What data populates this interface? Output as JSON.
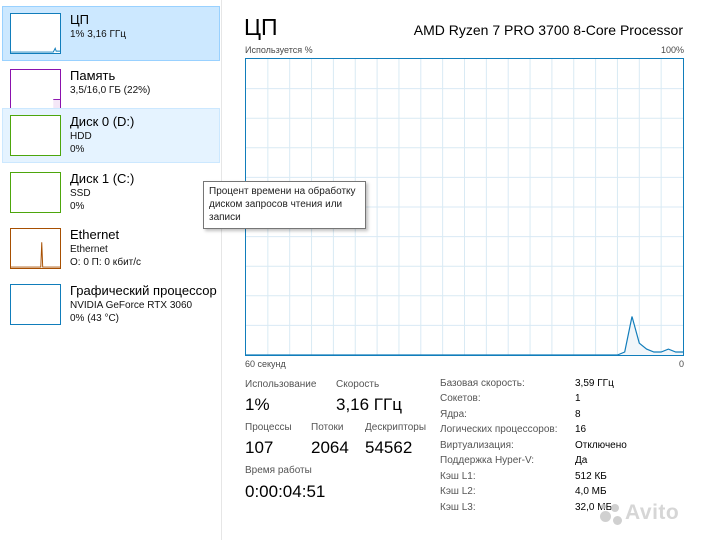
{
  "sidebar": {
    "items": [
      {
        "title": "ЦП",
        "sub1": "1% 3,16 ГГц",
        "sub2": "",
        "border": "#117dbb",
        "state": "selected"
      },
      {
        "title": "Память",
        "sub1": "3,5/16,0 ГБ (22%)",
        "sub2": "",
        "border": "#8b12ae",
        "state": ""
      },
      {
        "title": "Диск 0 (D:)",
        "sub1": "HDD",
        "sub2": "0%",
        "border": "#4da60c",
        "state": "hovered"
      },
      {
        "title": "Диск 1 (C:)",
        "sub1": "SSD",
        "sub2": "0%",
        "border": "#4da60c",
        "state": ""
      },
      {
        "title": "Ethernet",
        "sub1": "Ethernet",
        "sub2": "О: 0 П: 0 кбит/с",
        "border": "#a74f01",
        "state": ""
      },
      {
        "title": "Графический процессор",
        "sub1": "NVIDIA GeForce RTX 3060",
        "sub2": "0% (43 °C)",
        "border": "#117dbb",
        "state": ""
      }
    ]
  },
  "main": {
    "title": "ЦП",
    "cpu_name": "AMD Ryzen 7 PRO 3700 8-Core Processor",
    "axis": {
      "top_left": "Используется %",
      "top_right": "100%",
      "bottom_left": "60 секунд",
      "bottom_right": "0"
    }
  },
  "chart_data": {
    "type": "area",
    "ylabel": "Используется %",
    "ylim": [
      0,
      100
    ],
    "xlim": [
      60,
      0
    ],
    "x_unit": "секунд",
    "grid": true,
    "color": "#117dbb",
    "fill": "#f1f6fa",
    "x": [
      60,
      9,
      8,
      7,
      6,
      5,
      4,
      3,
      2,
      1,
      0
    ],
    "values": [
      0,
      0,
      1,
      13,
      4,
      2,
      1,
      1,
      2,
      1,
      1
    ]
  },
  "stats": {
    "usage_label": "Использование",
    "usage_value": "1%",
    "speed_label": "Скорость",
    "speed_value": "3,16 ГГц",
    "processes_label": "Процессы",
    "processes_value": "107",
    "threads_label": "Потоки",
    "threads_value": "2064",
    "handles_label": "Дескрипторы",
    "handles_value": "54562",
    "uptime_label": "Время работы",
    "uptime_value": "0:00:04:51"
  },
  "specs": [
    {
      "label": "Базовая скорость:",
      "value": "3,59 ГГц"
    },
    {
      "label": "Сокетов:",
      "value": "1"
    },
    {
      "label": "Ядра:",
      "value": "8"
    },
    {
      "label": "Логических процессоров:",
      "value": "16"
    },
    {
      "label": "Виртуализация:",
      "value": "Отключено"
    },
    {
      "label": "Поддержка Hyper-V:",
      "value": "Да"
    },
    {
      "label": "Кэш L1:",
      "value": "512 КБ"
    },
    {
      "label": "Кэш L2:",
      "value": "4,0 МБ"
    },
    {
      "label": "Кэш L3:",
      "value": "32,0 МБ"
    }
  ],
  "tooltip": {
    "text": "Процент времени на обработку диском запросов чтения или записи"
  },
  "watermark": {
    "text": "Avito"
  }
}
